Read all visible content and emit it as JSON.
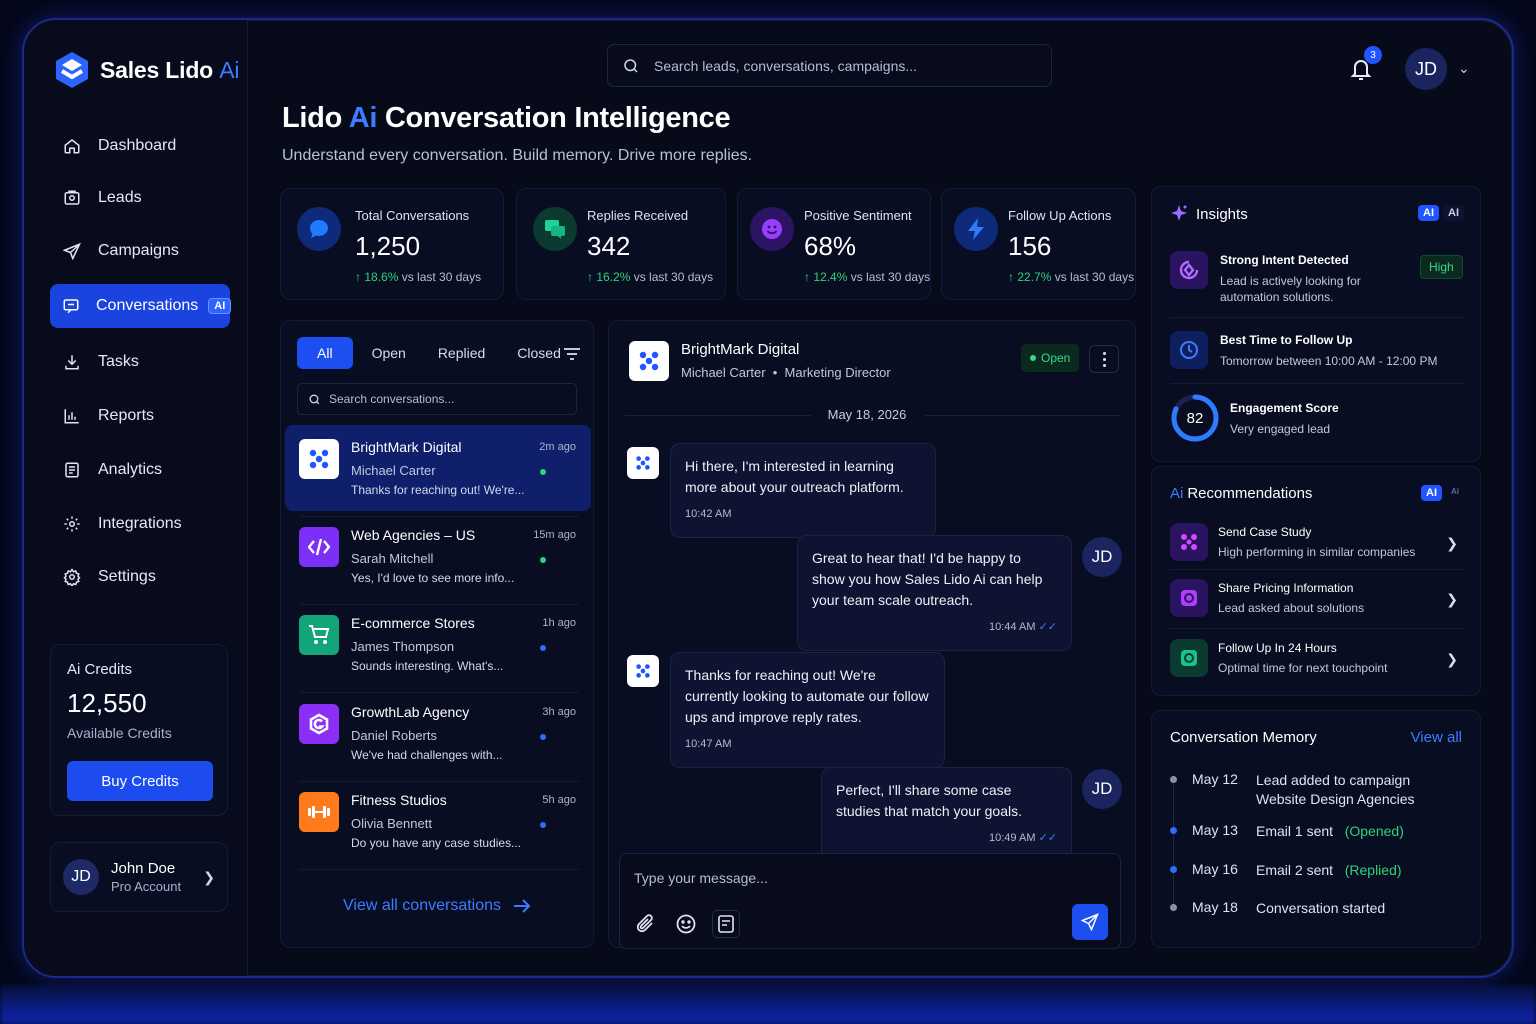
{
  "brand": {
    "name": "Sales Lido",
    "ai": "Ai"
  },
  "nav": [
    {
      "label": "Dashboard",
      "icon": "home-icon"
    },
    {
      "label": "Leads",
      "icon": "leads-icon"
    },
    {
      "label": "Campaigns",
      "icon": "send-icon"
    },
    {
      "label": "Conversations",
      "icon": "chat-icon",
      "tag": "AI",
      "active": true
    },
    {
      "label": "Tasks",
      "icon": "download-icon"
    },
    {
      "label": "Reports",
      "icon": "bar-chart-icon"
    },
    {
      "label": "Analytics",
      "icon": "analytics-icon"
    },
    {
      "label": "Integrations",
      "icon": "integrations-gear-icon"
    },
    {
      "label": "Settings",
      "icon": "gear-icon"
    }
  ],
  "credits": {
    "label": "Ai Credits",
    "value": "12,550",
    "sub": "Available Credits",
    "button": "Buy Credits"
  },
  "user": {
    "initials": "JD",
    "name": "John Doe",
    "role": "Pro Account"
  },
  "search": {
    "placeholder": "Search leads, conversations, campaigns..."
  },
  "notifications": {
    "count": "3"
  },
  "top_user": {
    "initials": "JD"
  },
  "page": {
    "title_pre": "Lido",
    "title_ai": "Ai",
    "title_post": "Conversation Intelligence",
    "subtitle": "Understand every conversation. Build memory. Drive more replies."
  },
  "stats": [
    {
      "title": "Total Conversations",
      "value": "1,250",
      "delta": "18.6%",
      "compare": "vs last 30 days",
      "color": "#1f5cff",
      "icon": "speech-bubble-icon"
    },
    {
      "title": "Replies Received",
      "value": "342",
      "delta": "16.2%",
      "compare": "vs last 30 days",
      "color": "#17c58a",
      "icon": "replies-icon"
    },
    {
      "title": "Positive Sentiment",
      "value": "68%",
      "delta": "12.4%",
      "compare": "vs last 30 days",
      "color": "#8a3dff",
      "icon": "smile-icon"
    },
    {
      "title": "Follow Up Actions",
      "value": "156",
      "delta": "22.7%",
      "compare": "vs last 30 days",
      "color": "#1f5cff",
      "icon": "lightning-icon"
    }
  ],
  "filters": {
    "tabs": [
      "All",
      "Open",
      "Replied",
      "Closed"
    ],
    "active": "All",
    "search_placeholder": "Search conversations..."
  },
  "conversations": [
    {
      "name": "BrightMark Digital",
      "person": "Michael Carter",
      "preview": "Thanks for reaching out! We're...",
      "time": "2m ago",
      "dot": "#2fd37a",
      "icon_bg": "#ffffff",
      "icon": "brightmark-logo-icon",
      "active": true
    },
    {
      "name": "Web Agencies – US",
      "person": "Sarah Mitchell",
      "preview": "Yes, I'd love to see more info...",
      "time": "15m ago",
      "dot": "#2fd37a",
      "icon_bg": "#7b2ff7",
      "icon": "code-icon"
    },
    {
      "name": "E-commerce Stores",
      "person": "James Thompson",
      "preview": "Sounds interesting. What's...",
      "time": "1h ago",
      "dot": "#2f6bff",
      "icon_bg": "#12a57a",
      "icon": "cart-icon"
    },
    {
      "name": "GrowthLab Agency",
      "person": "Daniel Roberts",
      "preview": "We've had challenges with...",
      "time": "3h ago",
      "dot": "#2f6bff",
      "icon_bg": "#8b2ff7",
      "icon": "growthlab-logo-icon"
    },
    {
      "name": "Fitness Studios",
      "person": "Olivia Bennett",
      "preview": "Do you have any case studies...",
      "time": "5h ago",
      "dot": "#2f6bff",
      "icon_bg": "#ff7a1a",
      "icon": "dumbbell-icon"
    }
  ],
  "view_all_conversations": "View all conversations",
  "chat": {
    "name": "BrightMark Digital",
    "person": "Michael Carter",
    "role": "Marketing Director",
    "status": "Open",
    "date": "May 18, 2026",
    "messages": [
      {
        "dir": "in",
        "text": "Hi there, I'm interested in learning more about your outreach platform.",
        "time": "10:42 AM"
      },
      {
        "dir": "out",
        "text": "Great to hear that! I'd be happy to show you how Sales Lido Ai can help your team scale outreach.",
        "time": "10:44 AM",
        "avatar": "JD"
      },
      {
        "dir": "in",
        "text": "Thanks for reaching out! We're currently looking to automate our follow ups and improve reply rates.",
        "time": "10:47 AM"
      },
      {
        "dir": "out",
        "text": "Perfect, I'll share some case studies that match your goals.",
        "time": "10:49 AM",
        "avatar": "JD"
      }
    ],
    "compose_placeholder": "Type your message..."
  },
  "insights": {
    "title": "Insights",
    "chips": [
      "AI",
      "AI"
    ],
    "items": [
      {
        "title": "Strong Intent Detected",
        "sub": "Lead is actively looking for automation solutions.",
        "badge": "High",
        "icon": "intent-icon"
      },
      {
        "title": "Best Time to Follow Up",
        "sub": "Tomorrow between 10:00 AM - 12:00 PM",
        "icon": "clock-icon"
      }
    ],
    "engagement": {
      "score": "82",
      "score_fraction": 0.82,
      "title": "Engagement Score",
      "sub": "Very engaged lead"
    }
  },
  "recommendations": {
    "title_ai": "Ai",
    "title": "Recommendations",
    "chips": [
      "AI",
      "Ai"
    ],
    "items": [
      {
        "title": "Send Case Study",
        "sub": "High performing in similar companies",
        "icon": "case-study-icon",
        "color": "#c33bff"
      },
      {
        "title": "Share Pricing Information",
        "sub": "Lead asked about solutions",
        "icon": "pricing-icon",
        "color": "#b13bff"
      },
      {
        "title": "Follow Up In 24 Hours",
        "sub": "Optimal time for next touchpoint",
        "icon": "target-icon",
        "color": "#17c58a"
      }
    ]
  },
  "memory": {
    "title": "Conversation Memory",
    "view_all": "View all",
    "items": [
      {
        "date": "May 12",
        "text": "Lead added to campaign",
        "text2": "Website Design Agencies",
        "dot": "#8a90a8"
      },
      {
        "date": "May 13",
        "text": "Email 1 sent",
        "status": "(Opened)",
        "dot": "#2f6bff"
      },
      {
        "date": "May 16",
        "text": "Email 2 sent",
        "status": "(Replied)",
        "dot": "#2f6bff"
      },
      {
        "date": "May 18",
        "text": "Conversation started",
        "dot": "#8a90a8"
      }
    ]
  }
}
